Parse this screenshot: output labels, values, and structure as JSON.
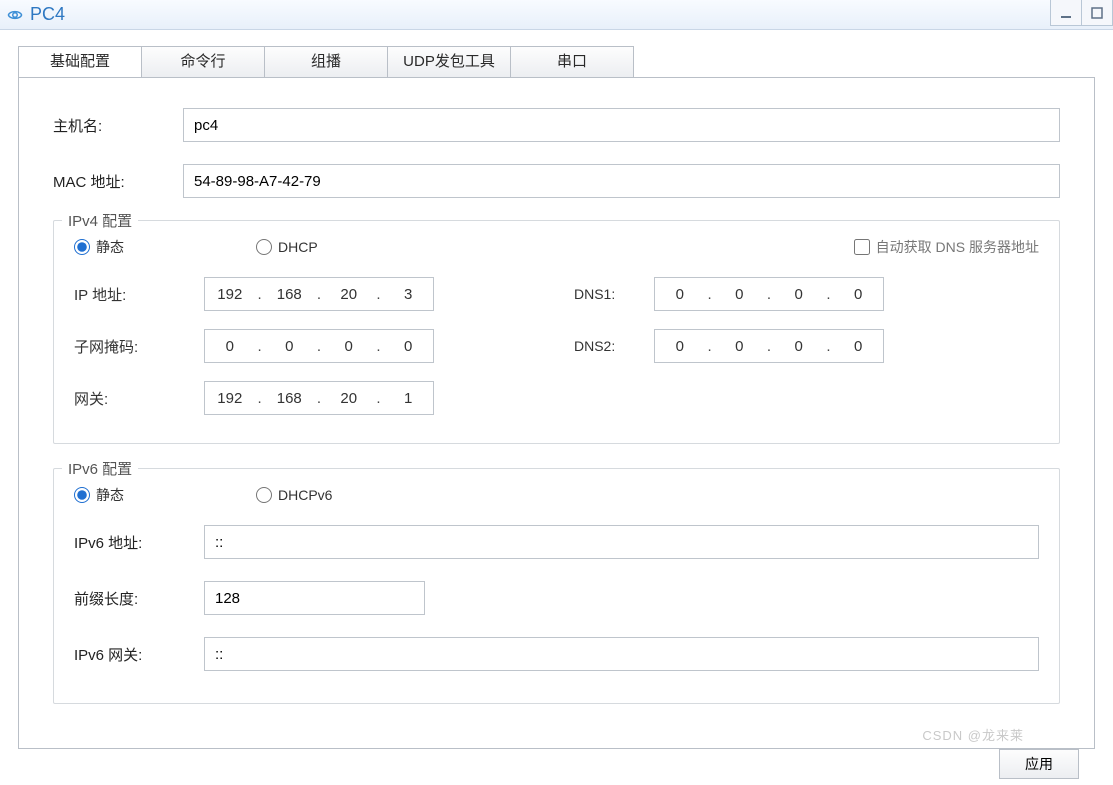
{
  "window": {
    "title": "PC4"
  },
  "tabs": [
    "基础配置",
    "命令行",
    "组播",
    "UDP发包工具",
    "串口"
  ],
  "active_tab": 0,
  "basic": {
    "hostname_label": "主机名:",
    "hostname_value": "pc4",
    "mac_label": "MAC 地址:",
    "mac_value": "54-89-98-A7-42-79"
  },
  "ipv4": {
    "legend": "IPv4 配置",
    "static_label": "静态",
    "dhcp_label": "DHCP",
    "auto_dns_label": "自动获取 DNS 服务器地址",
    "ip_label": "IP 地址:",
    "ip": [
      "192",
      "168",
      "20",
      "3"
    ],
    "mask_label": "子网掩码:",
    "mask": [
      "0",
      "0",
      "0",
      "0"
    ],
    "gw_label": "网关:",
    "gw": [
      "192",
      "168",
      "20",
      "1"
    ],
    "dns1_label": "DNS1:",
    "dns1": [
      "0",
      "0",
      "0",
      "0"
    ],
    "dns2_label": "DNS2:",
    "dns2": [
      "0",
      "0",
      "0",
      "0"
    ]
  },
  "ipv6": {
    "legend": "IPv6 配置",
    "static_label": "静态",
    "dhcp_label": "DHCPv6",
    "addr_label": "IPv6 地址:",
    "addr_value": "::",
    "prefix_label": "前缀长度:",
    "prefix_value": "128",
    "gw_label": "IPv6 网关:",
    "gw_value": "::"
  },
  "apply_label": "应用",
  "watermark": "CSDN @龙来莱"
}
